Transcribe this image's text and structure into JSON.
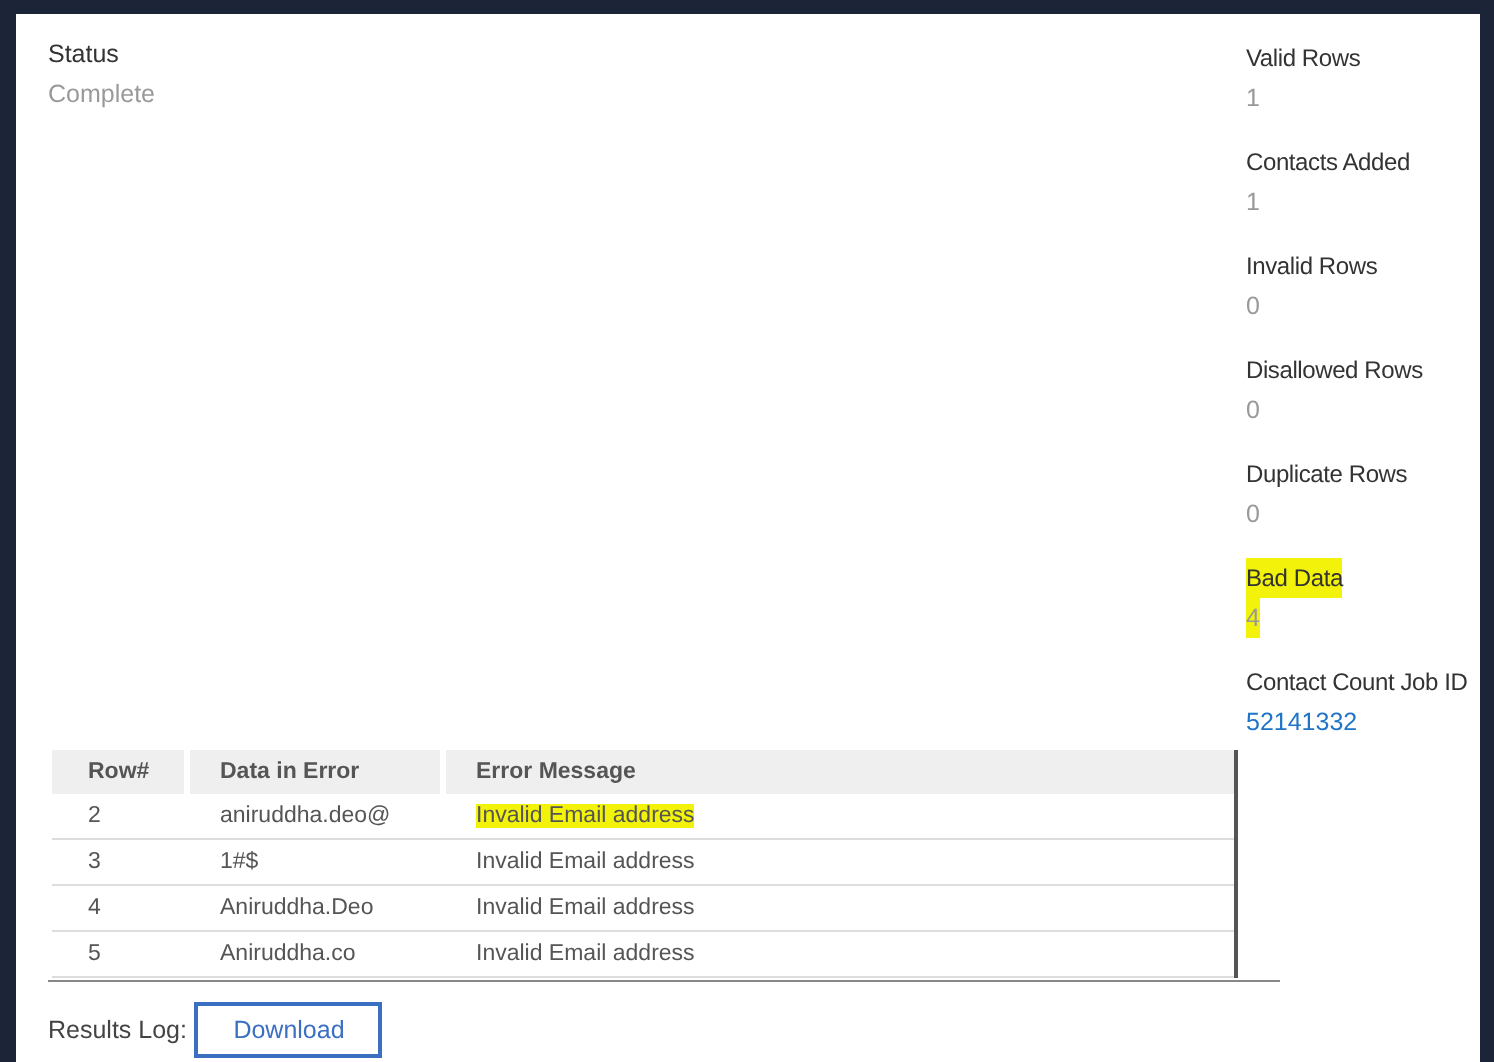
{
  "status": {
    "label": "Status",
    "value": "Complete"
  },
  "stats": [
    {
      "label": "Valid Rows",
      "value": "1",
      "kind": "plain",
      "highlighted": false
    },
    {
      "label": "Contacts Added",
      "value": "1",
      "kind": "plain",
      "highlighted": false
    },
    {
      "label": "Invalid Rows",
      "value": "0",
      "kind": "plain",
      "highlighted": false
    },
    {
      "label": "Disallowed Rows",
      "value": "0",
      "kind": "plain",
      "highlighted": false
    },
    {
      "label": "Duplicate Rows",
      "value": "0",
      "kind": "plain",
      "highlighted": false
    },
    {
      "label": "Bad Data",
      "value": "4",
      "kind": "plain",
      "highlighted": true
    },
    {
      "label": "Contact Count Job ID",
      "value": "52141332",
      "kind": "link",
      "highlighted": false
    }
  ],
  "table": {
    "columns": [
      "Row#",
      "Data in Error",
      "Error Message"
    ],
    "rows": [
      {
        "cells": [
          "2",
          "aniruddha.deo@",
          "Invalid Email address"
        ],
        "highlighted": true
      },
      {
        "cells": [
          "3",
          "1#$",
          "Invalid Email address"
        ],
        "highlighted": false
      },
      {
        "cells": [
          "4",
          "Aniruddha.Deo",
          "Invalid Email address"
        ],
        "highlighted": false
      },
      {
        "cells": [
          "5",
          "Aniruddha.co",
          "Invalid Email address"
        ],
        "highlighted": false
      }
    ]
  },
  "results_log": {
    "label": "Results Log:",
    "button": "Download"
  }
}
